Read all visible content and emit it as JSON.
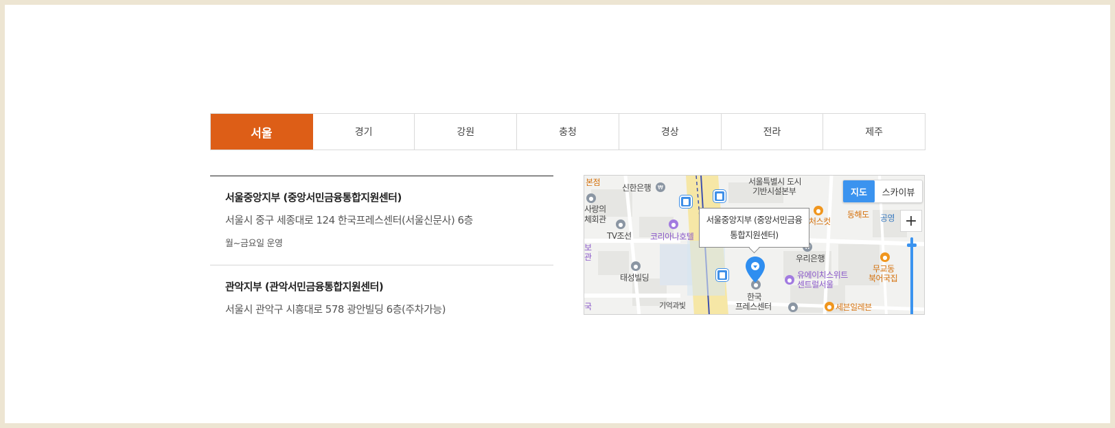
{
  "tabs": [
    {
      "label": "서울",
      "active": true
    },
    {
      "label": "경기",
      "active": false
    },
    {
      "label": "강원",
      "active": false
    },
    {
      "label": "충청",
      "active": false
    },
    {
      "label": "경상",
      "active": false
    },
    {
      "label": "전라",
      "active": false
    },
    {
      "label": "제주",
      "active": false
    }
  ],
  "branches": [
    {
      "name": "서울중앙지부 (중앙서민금융통합지원센터)",
      "address": "서울시 중구 세종대로 124 한국프레스센터(서울신문사) 6층",
      "hours": "월~금요일 운영"
    },
    {
      "name": "관악지부 (관악서민금융통합지원센터)",
      "address": "서울시 관악구 시흥대로 578 광안빌딩 6층(주차가능)",
      "hours": ""
    }
  ],
  "map": {
    "tooltip_line1": "서울중앙지부 (중앙서민금융",
    "tooltip_line2": "통합지원센터)",
    "type_map": "지도",
    "type_sky": "스카이뷰",
    "zoom_in": "+",
    "labels": {
      "l1": "본점",
      "l2": "신한은행",
      "l3": "서울특별시 도시",
      "l4": "기반시설본부",
      "l5": "사랑의",
      "l6": "체회관",
      "l7": "TV조선",
      "l8": "코리아나호텔",
      "l9": "처스컷",
      "l10": "동해도",
      "l11": "공영",
      "l12": "보",
      "l13": "관",
      "l14": "우리은행",
      "l15": "태성빌딩",
      "l16": "유에이치스위트",
      "l17": "센트럴서울",
      "l18": "무교동",
      "l19": "북어국집",
      "l20": "한국",
      "l21": "프레스센터",
      "l22": "기억과빛",
      "l23": "세븐일레븐",
      "l24": "국"
    },
    "colors": {
      "road_yellow": "#f6e7a6",
      "accent_blue": "#3b93ef",
      "tab_active": "#dd5e17"
    }
  }
}
